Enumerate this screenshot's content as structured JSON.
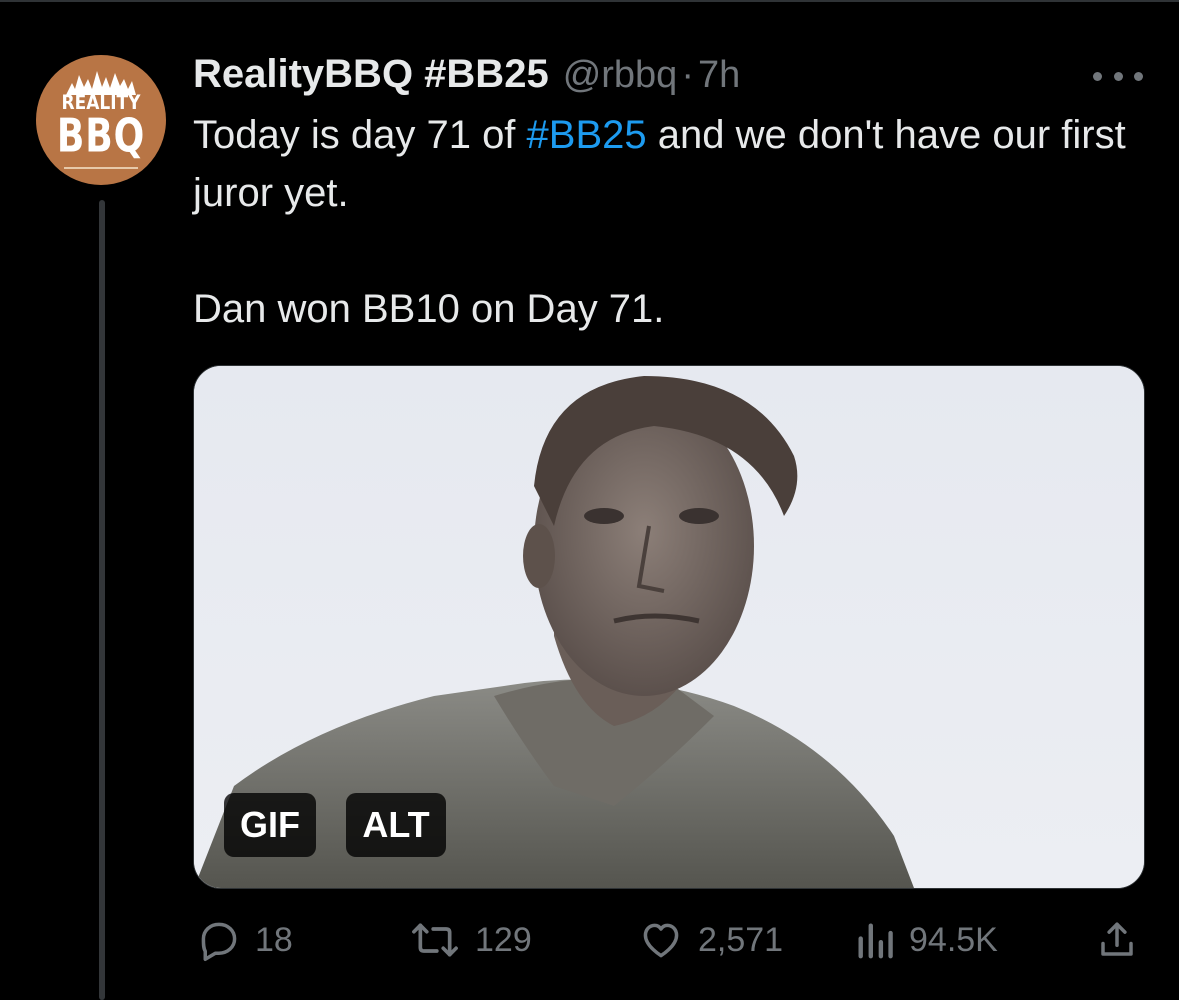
{
  "colors": {
    "background": "#000000",
    "text": "#e7e9ea",
    "muted": "#71767b",
    "link": "#1d9bf0",
    "avatar_bg": "#b87545"
  },
  "avatar": {
    "line1": "REALITY",
    "line2": "BBQ"
  },
  "tweet": {
    "display_name": "RealityBBQ #BB25",
    "handle": "@rbbq",
    "separator": "·",
    "time": "7h",
    "text_part1": "Today is day 71 of ",
    "hashtag": "#BB25",
    "text_part2": " and we don't have our first juror yet.",
    "line2": "Dan won BB10 on Day 71."
  },
  "media": {
    "gif_badge": "GIF",
    "alt_badge": "ALT"
  },
  "actions": {
    "replies": "18",
    "retweets": "129",
    "likes": "2,571",
    "views": "94.5K"
  },
  "icons": [
    "reply-icon",
    "retweet-icon",
    "like-icon",
    "views-icon",
    "share-icon",
    "more-icon"
  ]
}
